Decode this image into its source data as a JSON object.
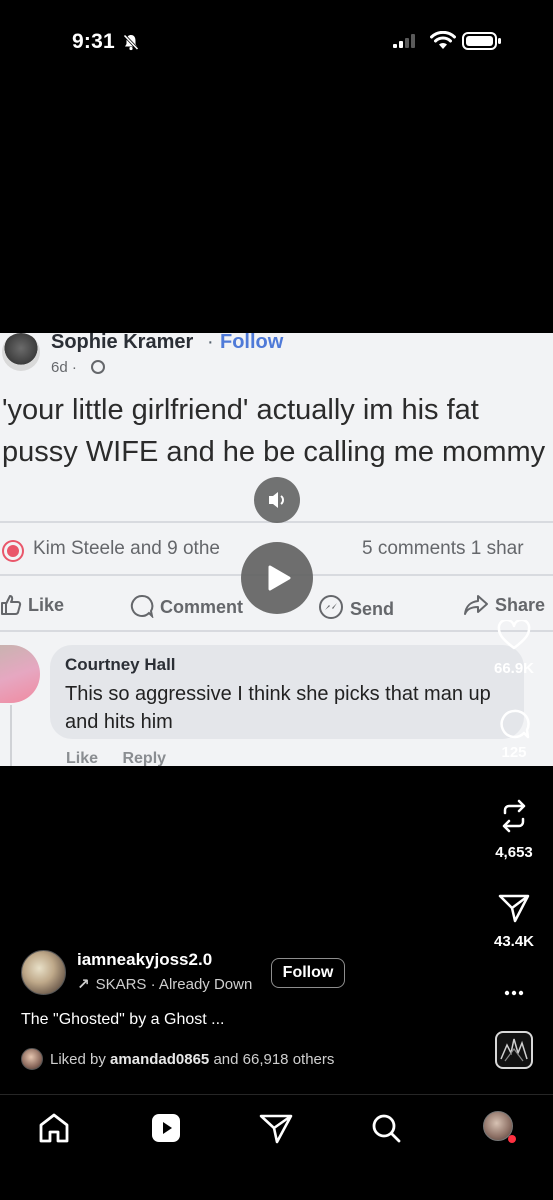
{
  "status_bar": {
    "time": "9:31"
  },
  "video": {
    "post": {
      "author": "Sophie Kramer",
      "follow": "Follow",
      "separator": "·",
      "time": "6d ·",
      "text": "'your little girlfriend' actually im his fat pussy WIFE and he be calling me mommy",
      "reactions": "Kim Steele and 9 othe",
      "comments_share": "5 comments  1 shar",
      "actions": [
        "Like",
        "Comment",
        "Send",
        "Share"
      ]
    },
    "comment": {
      "author": "Courtney Hall",
      "text": "This so aggressive I think she picks that man up and hits him",
      "meta": [
        "Like",
        "Reply"
      ]
    }
  },
  "rail": {
    "likes": "66.9K",
    "comments": "125",
    "reposts": "4,653",
    "shares": "43.4K"
  },
  "reel": {
    "username": "iamneakyjoss2.0",
    "audio": "SKARS · Already Down",
    "follow_label": "Follow",
    "caption": "The \"Ghosted\" by a Ghost ...",
    "liked_by_prefix": "Liked by ",
    "liked_by_user": "amandad0865",
    "liked_by_suffix": " and 66,918 others"
  },
  "nav": {
    "items": [
      "home-icon",
      "reels-icon",
      "send-icon",
      "search-icon",
      "profile-avatar"
    ]
  }
}
